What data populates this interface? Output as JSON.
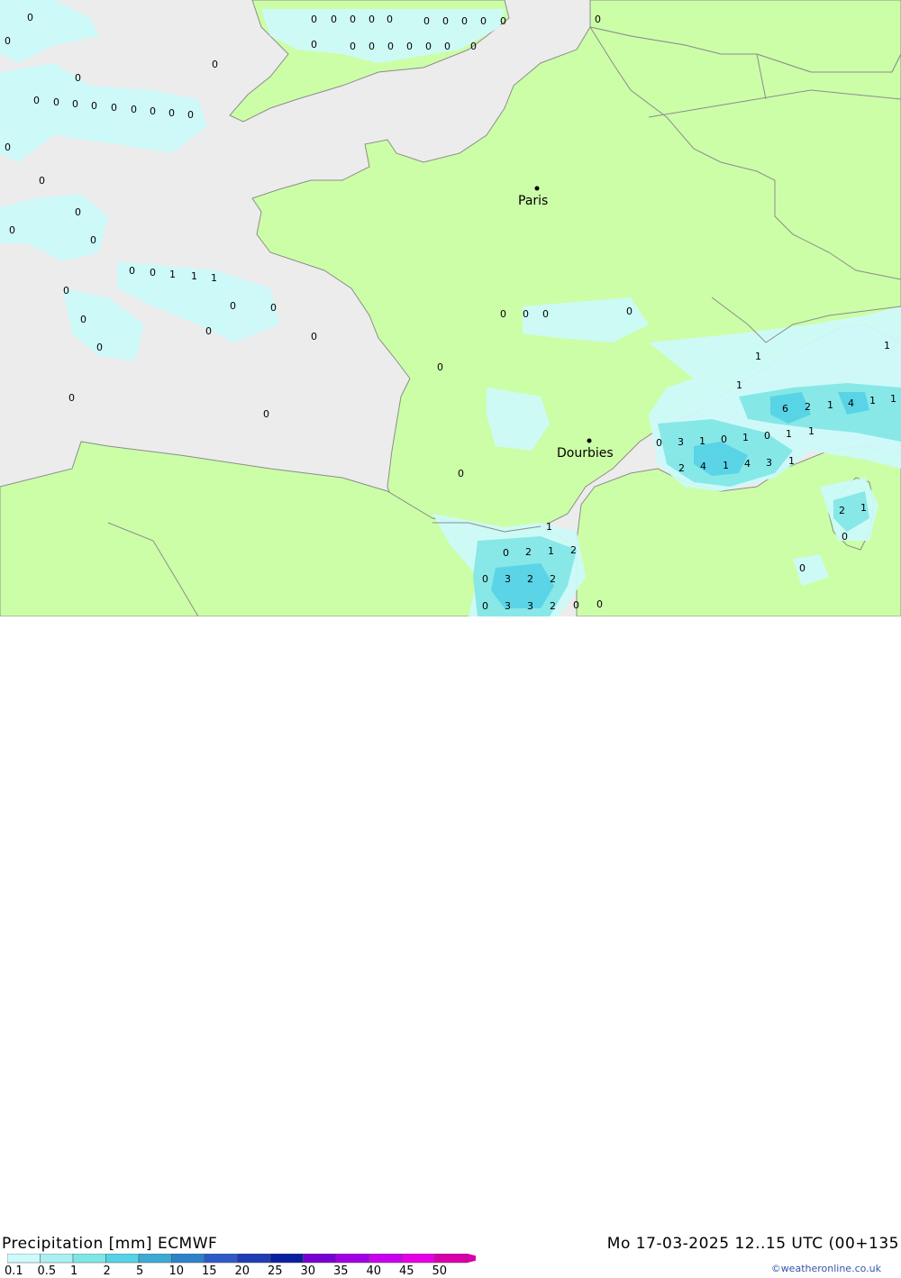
{
  "header": {
    "left": "Precipitation [mm] ECMWF",
    "right": "Mo 17-03-2025 12..15 UTC (00+135"
  },
  "credit": "©weatheronline.co.uk",
  "colors": {
    "sea": "#ececec",
    "land": "#ccfea8",
    "border": "#8c8c8c"
  },
  "legend": {
    "labels": [
      "0.1",
      "0.5",
      "1",
      "2",
      "5",
      "10",
      "15",
      "20",
      "25",
      "30",
      "35",
      "40",
      "45",
      "50"
    ],
    "colors": [
      "#cdfafa",
      "#aaf0f0",
      "#7fe6e6",
      "#55d2e6",
      "#3caad2",
      "#2d82c8",
      "#2d5ac8",
      "#1e3cb4",
      "#0a1ea0",
      "#7800d2",
      "#a000e6",
      "#c800f0",
      "#e600e6",
      "#d700aa"
    ]
  },
  "cities": [
    {
      "name": "Paris"
    },
    {
      "name": "Dourbies"
    }
  ],
  "values": {
    "row_uk_1": [
      "0",
      "0",
      "0",
      "0",
      "0",
      "0",
      "0",
      "0",
      "0",
      "0",
      "0"
    ],
    "row_uk_2": [
      "0",
      "0",
      "0",
      "0",
      "0",
      "0",
      "0",
      "0"
    ],
    "row_atl_1": [
      "0",
      "0",
      "0",
      "0",
      "0",
      "0",
      "0",
      "0",
      "0"
    ],
    "row_atl_2": [
      "0",
      "0",
      "1",
      "1",
      "1"
    ],
    "cluster_alps": [
      "6",
      "2",
      "1",
      "4",
      "1",
      "1"
    ],
    "cluster_prov_1": [
      "0",
      "3",
      "1",
      "0",
      "1",
      "0",
      "1",
      "1"
    ],
    "cluster_prov_2": [
      "2",
      "4",
      "1",
      "4",
      "3",
      "1"
    ],
    "cluster_spain_1": [
      "0",
      "2",
      "1",
      "2"
    ],
    "cluster_spain_2": [
      "0",
      "3",
      "2",
      "2"
    ],
    "cluster_spain_3": [
      "0",
      "3",
      "3",
      "2",
      "0",
      "0"
    ],
    "corsica": [
      "2",
      "1",
      "0"
    ],
    "scattered": [
      "0",
      "0",
      "0",
      "0",
      "0",
      "0",
      "0",
      "0",
      "0",
      "0",
      "0",
      "0",
      "0",
      "0",
      "0",
      "0",
      "0",
      "0",
      "0",
      "0",
      "0",
      "0",
      "1",
      "1",
      "1",
      "1",
      "0",
      "0",
      "0"
    ]
  }
}
